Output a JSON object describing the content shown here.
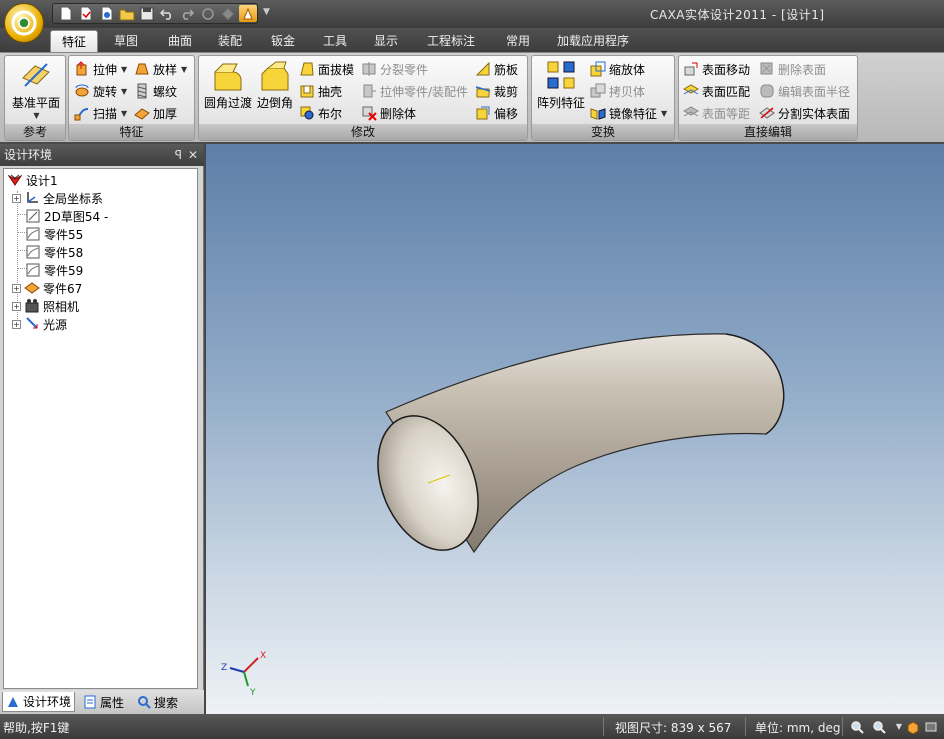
{
  "window": {
    "title": "CAXA实体设计2011 - [设计1]"
  },
  "tabs": [
    "特征",
    "草图",
    "曲面",
    "装配",
    "钣金",
    "工具",
    "显示",
    "工程标注",
    "常用",
    "加载应用程序"
  ],
  "ribbon": {
    "reference": {
      "label": "参考",
      "plane": "基准平面"
    },
    "feature": {
      "label": "特征",
      "extrude": "拉伸",
      "revolve": "旋转",
      "sweep": "扫描",
      "loft": "放样",
      "thread": "螺纹",
      "thicken": "加厚"
    },
    "modify": {
      "label": "修改",
      "fillet": "圆角过渡",
      "chamfer": "边倒角",
      "draft": "面拔模",
      "shell": "抽壳",
      "boolean": "布尔",
      "split_part": "分裂零件",
      "stretch_part": "拉伸零件/装配件",
      "delete_body": "删除体",
      "rib": "筋板",
      "trim": "裁剪",
      "offset": "偏移"
    },
    "transform": {
      "label": "变换",
      "pattern": "阵列特征",
      "scale": "缩放体",
      "copy": "拷贝体",
      "mirror": "镜像特征"
    },
    "direct_edit": {
      "label": "直接编辑",
      "move_face": "表面移动",
      "match_face": "表面匹配",
      "offset_face": "表面等距",
      "delete_face": "删除表面",
      "edit_radius": "编辑表面半径",
      "split_body": "分割实体表面"
    }
  },
  "panel": {
    "title": "设计环境",
    "pin": "ꟼ",
    "close": "✕",
    "tree": [
      {
        "label": "设计1"
      },
      {
        "label": "全局坐标系"
      },
      {
        "label": "2D草图54 -"
      },
      {
        "label": "零件55"
      },
      {
        "label": "零件58"
      },
      {
        "label": "零件59"
      },
      {
        "label": "零件67"
      },
      {
        "label": "照相机"
      },
      {
        "label": "光源"
      }
    ],
    "tabs": [
      "设计环境",
      "属性",
      "搜索"
    ]
  },
  "viewport": {
    "axis": {
      "x": "X",
      "y": "Y",
      "z": "Z"
    },
    "colors": {
      "bg_top": "#5d7fa8",
      "bg_bottom": "#eef2f6",
      "part": "#b8b0a4"
    }
  },
  "status": {
    "help": "帮助,按F1键",
    "view_size": "视图尺寸: 839 x 567",
    "units": "单位: mm, deg"
  }
}
